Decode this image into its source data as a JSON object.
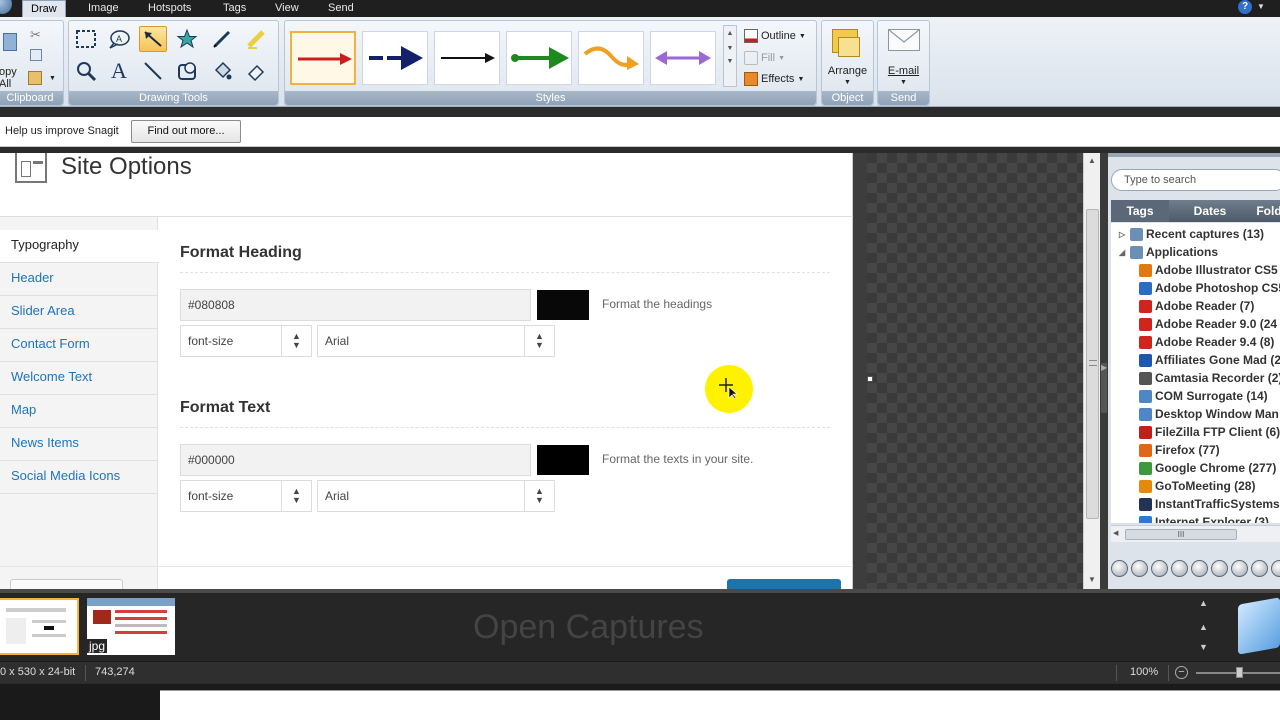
{
  "menu": {
    "tabs": [
      "Draw",
      "Image",
      "Hotspots",
      "Tags",
      "View",
      "Send"
    ],
    "active": "Draw"
  },
  "ribbon": {
    "clipboard": {
      "label": "Clipboard",
      "copy_label": "opy",
      "copy_label2": "All"
    },
    "drawing_tools": {
      "label": "Drawing Tools"
    },
    "styles": {
      "label": "Styles"
    },
    "format": {
      "outline": "Outline",
      "fill": "Fill",
      "effects": "Effects"
    },
    "object": {
      "label": "Object",
      "arrange": "Arrange"
    },
    "send": {
      "label": "Send",
      "email": "E-mail"
    }
  },
  "notice": {
    "text": "Help us improve Snagit",
    "button": "Find out more..."
  },
  "site_options": {
    "title": "Site Options",
    "nav": [
      "Typography",
      "Header",
      "Slider Area",
      "Contact Form",
      "Welcome Text",
      "Map",
      "News Items",
      "Social Media Icons"
    ],
    "active_nav": "Typography",
    "heading_section": {
      "title": "Format Heading",
      "color_value": "#080808",
      "swatch": "#080808",
      "description": "Format the headings",
      "size_select": "font-size",
      "font_select": "Arial"
    },
    "text_section": {
      "title": "Format Text",
      "color_value": "#000000",
      "swatch": "#000000",
      "description": "Format the texts in your site.",
      "size_select": "font-size",
      "font_select": "Arial"
    }
  },
  "library": {
    "search_placeholder": "Type to search",
    "tabs": [
      "Tags",
      "Dates",
      "Fold"
    ],
    "active_tab": "Tags",
    "tree": [
      {
        "label": "Recent captures (13)",
        "icon": "recent-icon",
        "color": "#6b8fb5",
        "level": 0,
        "expander": "▷"
      },
      {
        "label": "Applications",
        "icon": "applications-icon",
        "color": "#6b8fb5",
        "level": 0,
        "expander": "◢"
      },
      {
        "label": "Adobe Illustrator CS5",
        "icon": "illustrator-icon",
        "color": "#e07a10",
        "level": 1
      },
      {
        "label": "Adobe Photoshop CS5",
        "icon": "photoshop-icon",
        "color": "#2b6cc4",
        "level": 1
      },
      {
        "label": "Adobe Reader  (7)",
        "icon": "adobe-reader-icon",
        "color": "#d0251d",
        "level": 1
      },
      {
        "label": "Adobe Reader 9.0 (24",
        "icon": "adobe-reader-icon",
        "color": "#d0251d",
        "level": 1
      },
      {
        "label": "Adobe Reader 9.4 (8)",
        "icon": "adobe-reader-icon",
        "color": "#d0251d",
        "level": 1
      },
      {
        "label": "Affiliates Gone Mad (2",
        "icon": "affiliates-icon",
        "color": "#1e56b0",
        "level": 1
      },
      {
        "label": "Camtasia Recorder (2)",
        "icon": "camtasia-icon",
        "color": "#555555",
        "level": 1
      },
      {
        "label": "COM Surrogate (14)",
        "icon": "com-surrogate-icon",
        "color": "#4f86c6",
        "level": 1
      },
      {
        "label": "Desktop Window Man",
        "icon": "desktop-window-icon",
        "color": "#4f86c6",
        "level": 1
      },
      {
        "label": "FileZilla FTP Client (6)",
        "icon": "filezilla-icon",
        "color": "#c0201a",
        "level": 1
      },
      {
        "label": "Firefox (77)",
        "icon": "firefox-icon",
        "color": "#e0661a",
        "level": 1
      },
      {
        "label": "Google Chrome (277)",
        "icon": "chrome-icon",
        "color": "#3c9a3c",
        "level": 1
      },
      {
        "label": "GoToMeeting (28)",
        "icon": "gotomeeting-icon",
        "color": "#e08a10",
        "level": 1
      },
      {
        "label": "InstantTrafficSystems",
        "icon": "instanttraffic-icon",
        "color": "#223355",
        "level": 1
      },
      {
        "label": "Internet Explorer (3)",
        "icon": "ie-icon",
        "color": "#2a7ad0",
        "level": 1
      }
    ],
    "hscroll_grip": "III"
  },
  "tray": {
    "title": "Open Captures",
    "thumb_ext": "jpg"
  },
  "status": {
    "image_info": "0 x 530 x 24-bit",
    "cursor": "743,274",
    "zoom": "100%"
  }
}
